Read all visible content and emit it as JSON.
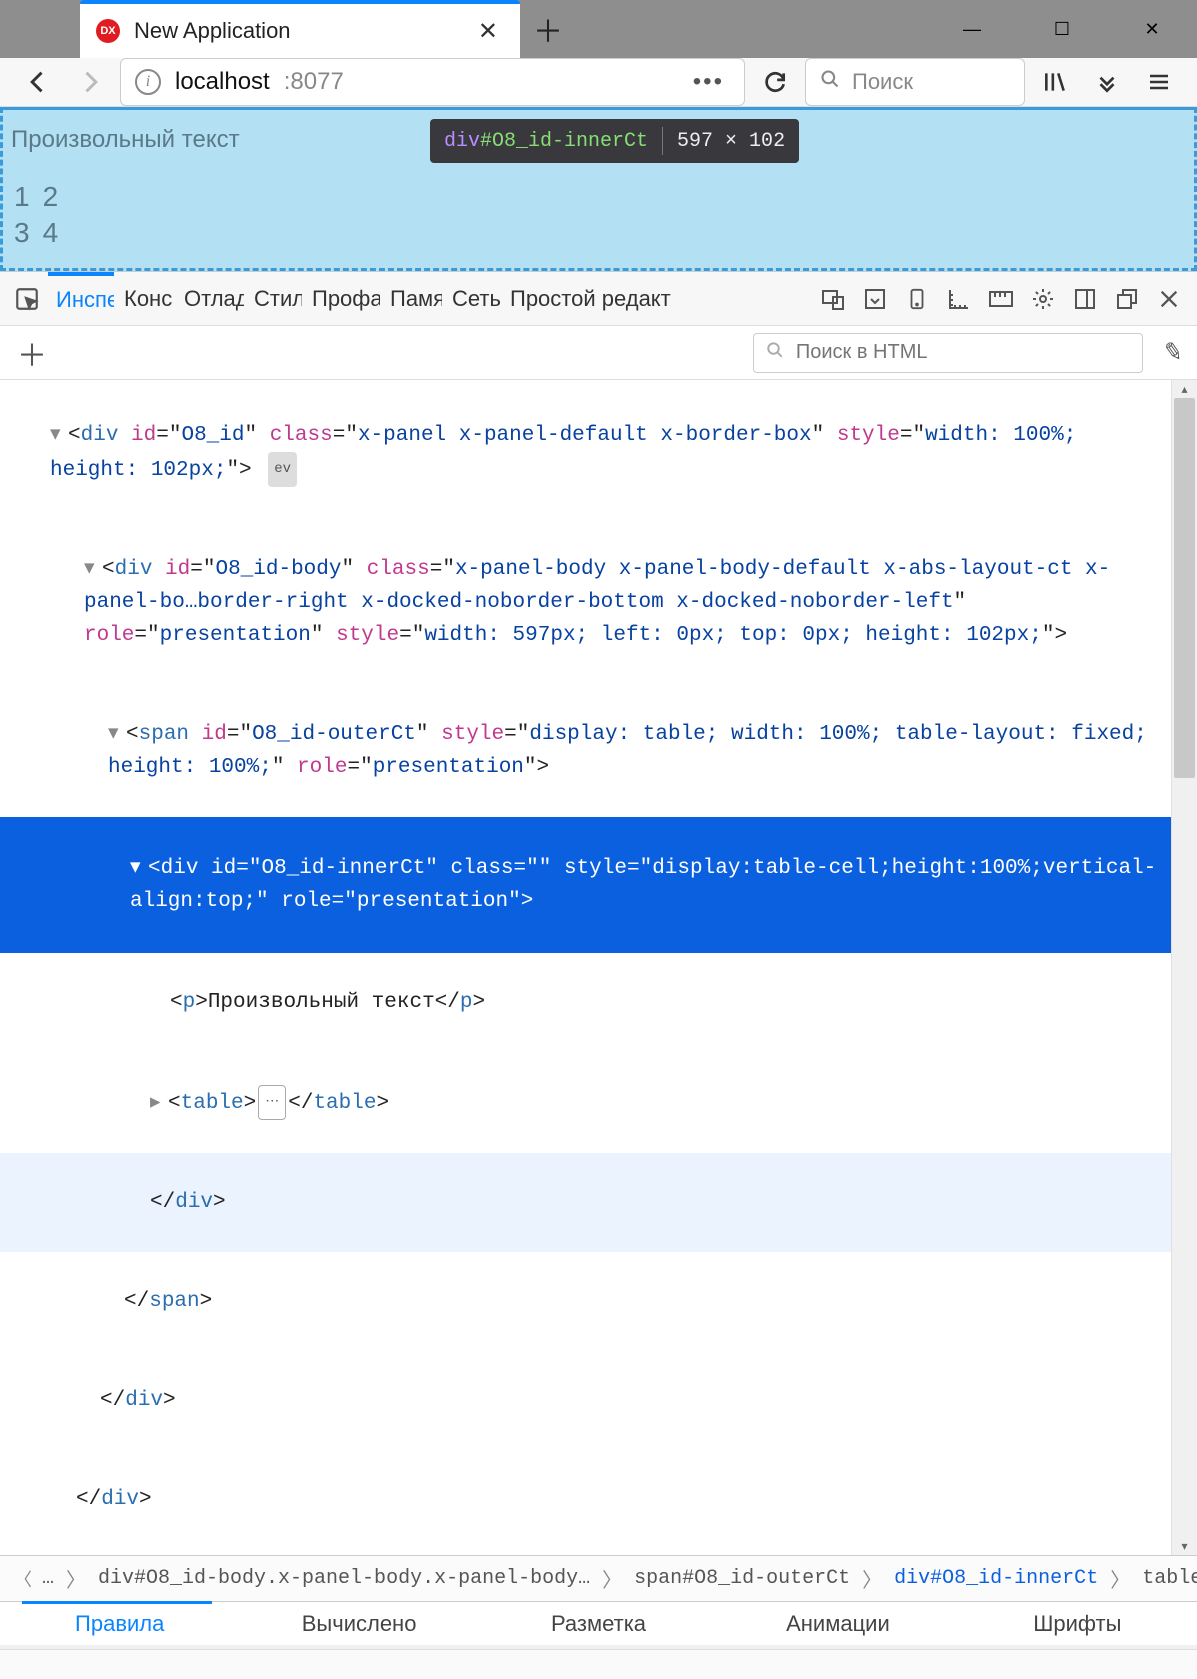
{
  "window": {
    "tab_title": "New Application",
    "favicon_text": "DX"
  },
  "navbar": {
    "url_host": "localhost",
    "url_port": ":8077",
    "search_placeholder": "Поиск"
  },
  "page": {
    "paragraph": "Произвольный текст",
    "table": [
      [
        "1",
        "2"
      ],
      [
        "3",
        "4"
      ]
    ],
    "tooltip": {
      "tag": "div",
      "id": "#O8_id-innerCt",
      "dims": "597 × 102"
    }
  },
  "devtools_tabs": [
    "Инспе",
    "Конс",
    "Отлад",
    "Стил",
    "Профа",
    "Памя",
    "Сеть",
    "Простой редакт"
  ],
  "dt_search_placeholder": "Поиск в HTML",
  "dom": {
    "l1": {
      "tag": "div",
      "a": [
        [
          "id",
          "O8_id"
        ],
        [
          "class",
          "x-panel x-panel-default x-border-box"
        ],
        [
          "style",
          "width: 100%; height: 102px;"
        ]
      ],
      "ev": "ev"
    },
    "l2": {
      "tag": "div",
      "a": [
        [
          "id",
          "O8_id-body"
        ],
        [
          "class",
          "x-panel-body x-panel-body-default x-abs-layout-ct x-panel-bo…border-right x-docked-noborder-bottom x-docked-noborder-left"
        ],
        [
          "role",
          "presentation"
        ],
        [
          "style",
          "width: 597px; left: 0px; top: 0px; height: 102px;"
        ]
      ]
    },
    "l3": {
      "tag": "span",
      "a": [
        [
          "id",
          "O8_id-outerCt"
        ],
        [
          "style",
          "display: table; width: 100%; table-layout: fixed; height: 100%;"
        ],
        [
          "role",
          "presentation"
        ]
      ]
    },
    "l4": {
      "tag": "div",
      "a": [
        [
          "id",
          "O8_id-innerCt"
        ],
        [
          "class",
          ""
        ],
        [
          "style",
          "display:table-cell;height:100%;vertical-align:top;"
        ],
        [
          "role",
          "presentation"
        ]
      ]
    },
    "l5": {
      "tag": "p",
      "text": "Произвольный текст"
    },
    "l6": {
      "tag": "table"
    },
    "c_div": "div",
    "c_span": "span"
  },
  "breadcrumbs": [
    {
      "txt": "…"
    },
    {
      "txt": "div#O8_id-body.x-panel-body.x-panel-body…"
    },
    {
      "txt": "span#O8_id-outerCt"
    },
    {
      "txt": "div#O8_id-innerCt",
      "sel": true
    },
    {
      "txt": "table"
    }
  ],
  "rules_tabs": [
    "Правила",
    "Вычислено",
    "Разметка",
    "Анимации",
    "Шрифты"
  ]
}
